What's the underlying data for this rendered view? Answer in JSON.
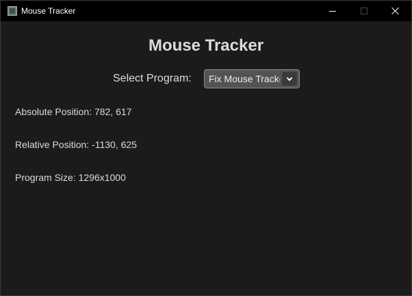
{
  "window": {
    "title": "Mouse Tracker",
    "icon": "app-icon",
    "controls": {
      "minimize": "minimize-icon",
      "maximize": "maximize-icon",
      "close": "close-icon"
    }
  },
  "header": {
    "title": "Mouse Tracker"
  },
  "program_select": {
    "label": "Select Program:",
    "selected": "Fix Mouse Tracker",
    "icon": "chevron-down-icon"
  },
  "info": {
    "absolute": "Absolute Position: 782, 617",
    "relative": "Relative Position: -1130, 625",
    "size": "Program Size: 1296x1000"
  },
  "colors": {
    "background": "#1b1b1b",
    "titlebar": "#000000",
    "select_bg": "#535353",
    "text": "#dcdcdc"
  }
}
